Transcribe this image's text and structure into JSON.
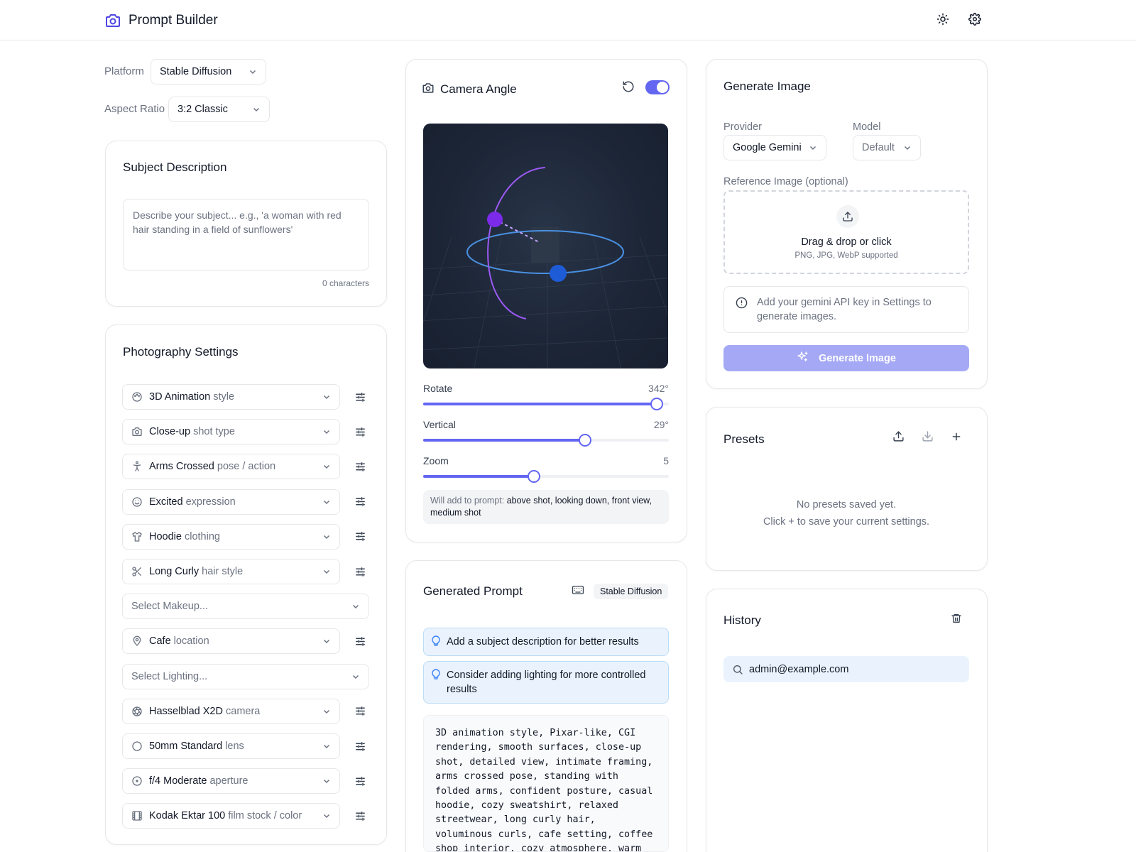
{
  "app": {
    "title": "Prompt Builder"
  },
  "controls": {
    "platform_label": "Platform",
    "platform_value": "Stable Diffusion",
    "aspect_label": "Aspect Ratio",
    "aspect_value": "3:2 Classic"
  },
  "subject": {
    "title": "Subject Description",
    "placeholder": "Describe your subject... e.g., 'a woman with red hair standing in a field of sunflowers'",
    "char_count": "0 characters"
  },
  "photography": {
    "title": "Photography Settings",
    "rows": [
      {
        "icon": "palette-icon",
        "value": "3D Animation",
        "suffix": "style"
      },
      {
        "icon": "camera-icon",
        "value": "Close-up",
        "suffix": "shot type"
      },
      {
        "icon": "person-icon",
        "value": "Arms Crossed",
        "suffix": "pose / action"
      },
      {
        "icon": "smile-icon",
        "value": "Excited",
        "suffix": "expression"
      },
      {
        "icon": "shirt-icon",
        "value": "Hoodie",
        "suffix": "clothing"
      },
      {
        "icon": "scissors-icon",
        "value": "Long Curly",
        "suffix": "hair style"
      },
      {
        "placeholder": "Select Makeup..."
      },
      {
        "icon": "map-pin-icon",
        "value": "Cafe",
        "suffix": "location"
      },
      {
        "placeholder": "Select Lighting..."
      },
      {
        "icon": "aperture-icon",
        "value": "Hasselblad X2D",
        "suffix": "camera"
      },
      {
        "icon": "circle-icon",
        "value": "50mm Standard",
        "suffix": "lens"
      },
      {
        "icon": "target-icon",
        "value": "f/4 Moderate",
        "suffix": "aperture"
      },
      {
        "icon": "film-icon",
        "value": "Kodak Ektar 100",
        "suffix": "film stock / color"
      }
    ]
  },
  "camera": {
    "title": "Camera Angle",
    "toggle_on": true,
    "rotate_label": "Rotate",
    "rotate_value": "342°",
    "rotate_pct": 0.95,
    "vertical_label": "Vertical",
    "vertical_value": "29°",
    "vertical_pct": 0.66,
    "zoom_label": "Zoom",
    "zoom_value": "5",
    "zoom_pct": 0.45,
    "note_prefix": "Will add to prompt:",
    "note_text": "above shot, looking down, front view, medium shot"
  },
  "generated": {
    "title": "Generated Prompt",
    "badge": "Stable Diffusion",
    "tips": [
      "Add a subject description for better results",
      "Consider adding lighting for more controlled results"
    ],
    "prompt_text": "3D animation style, Pixar-like, CGI rendering, smooth surfaces, close-up shot, detailed view, intimate framing, arms crossed pose, standing with folded arms, confident posture, casual hoodie, cozy sweatshirt, relaxed streetwear, long curly hair, voluminous curls, cafe setting, coffee shop interior, cozy atmosphere, warm ambiance, shot on"
  },
  "generate": {
    "title": "Generate Image",
    "provider_label": "Provider",
    "provider_value": "Google Gemini",
    "model_label": "Model",
    "model_value": "Default",
    "reference_label": "Reference Image (optional)",
    "drop_title": "Drag & drop or click",
    "drop_sub": "PNG, JPG, WebP supported",
    "info_text": "Add your gemini API key in Settings to generate images.",
    "button_label": "Generate Image"
  },
  "presets": {
    "title": "Presets",
    "empty_line1": "No presets saved yet.",
    "empty_line2": "Click + to save your current settings."
  },
  "history": {
    "title": "History",
    "search_value": "admin@example.com"
  },
  "colors": {
    "accent": "#6366f1",
    "accent_light": "#a5a9f5",
    "tip_bg": "#eaf3fd",
    "tip_border": "#bcdcf7"
  }
}
